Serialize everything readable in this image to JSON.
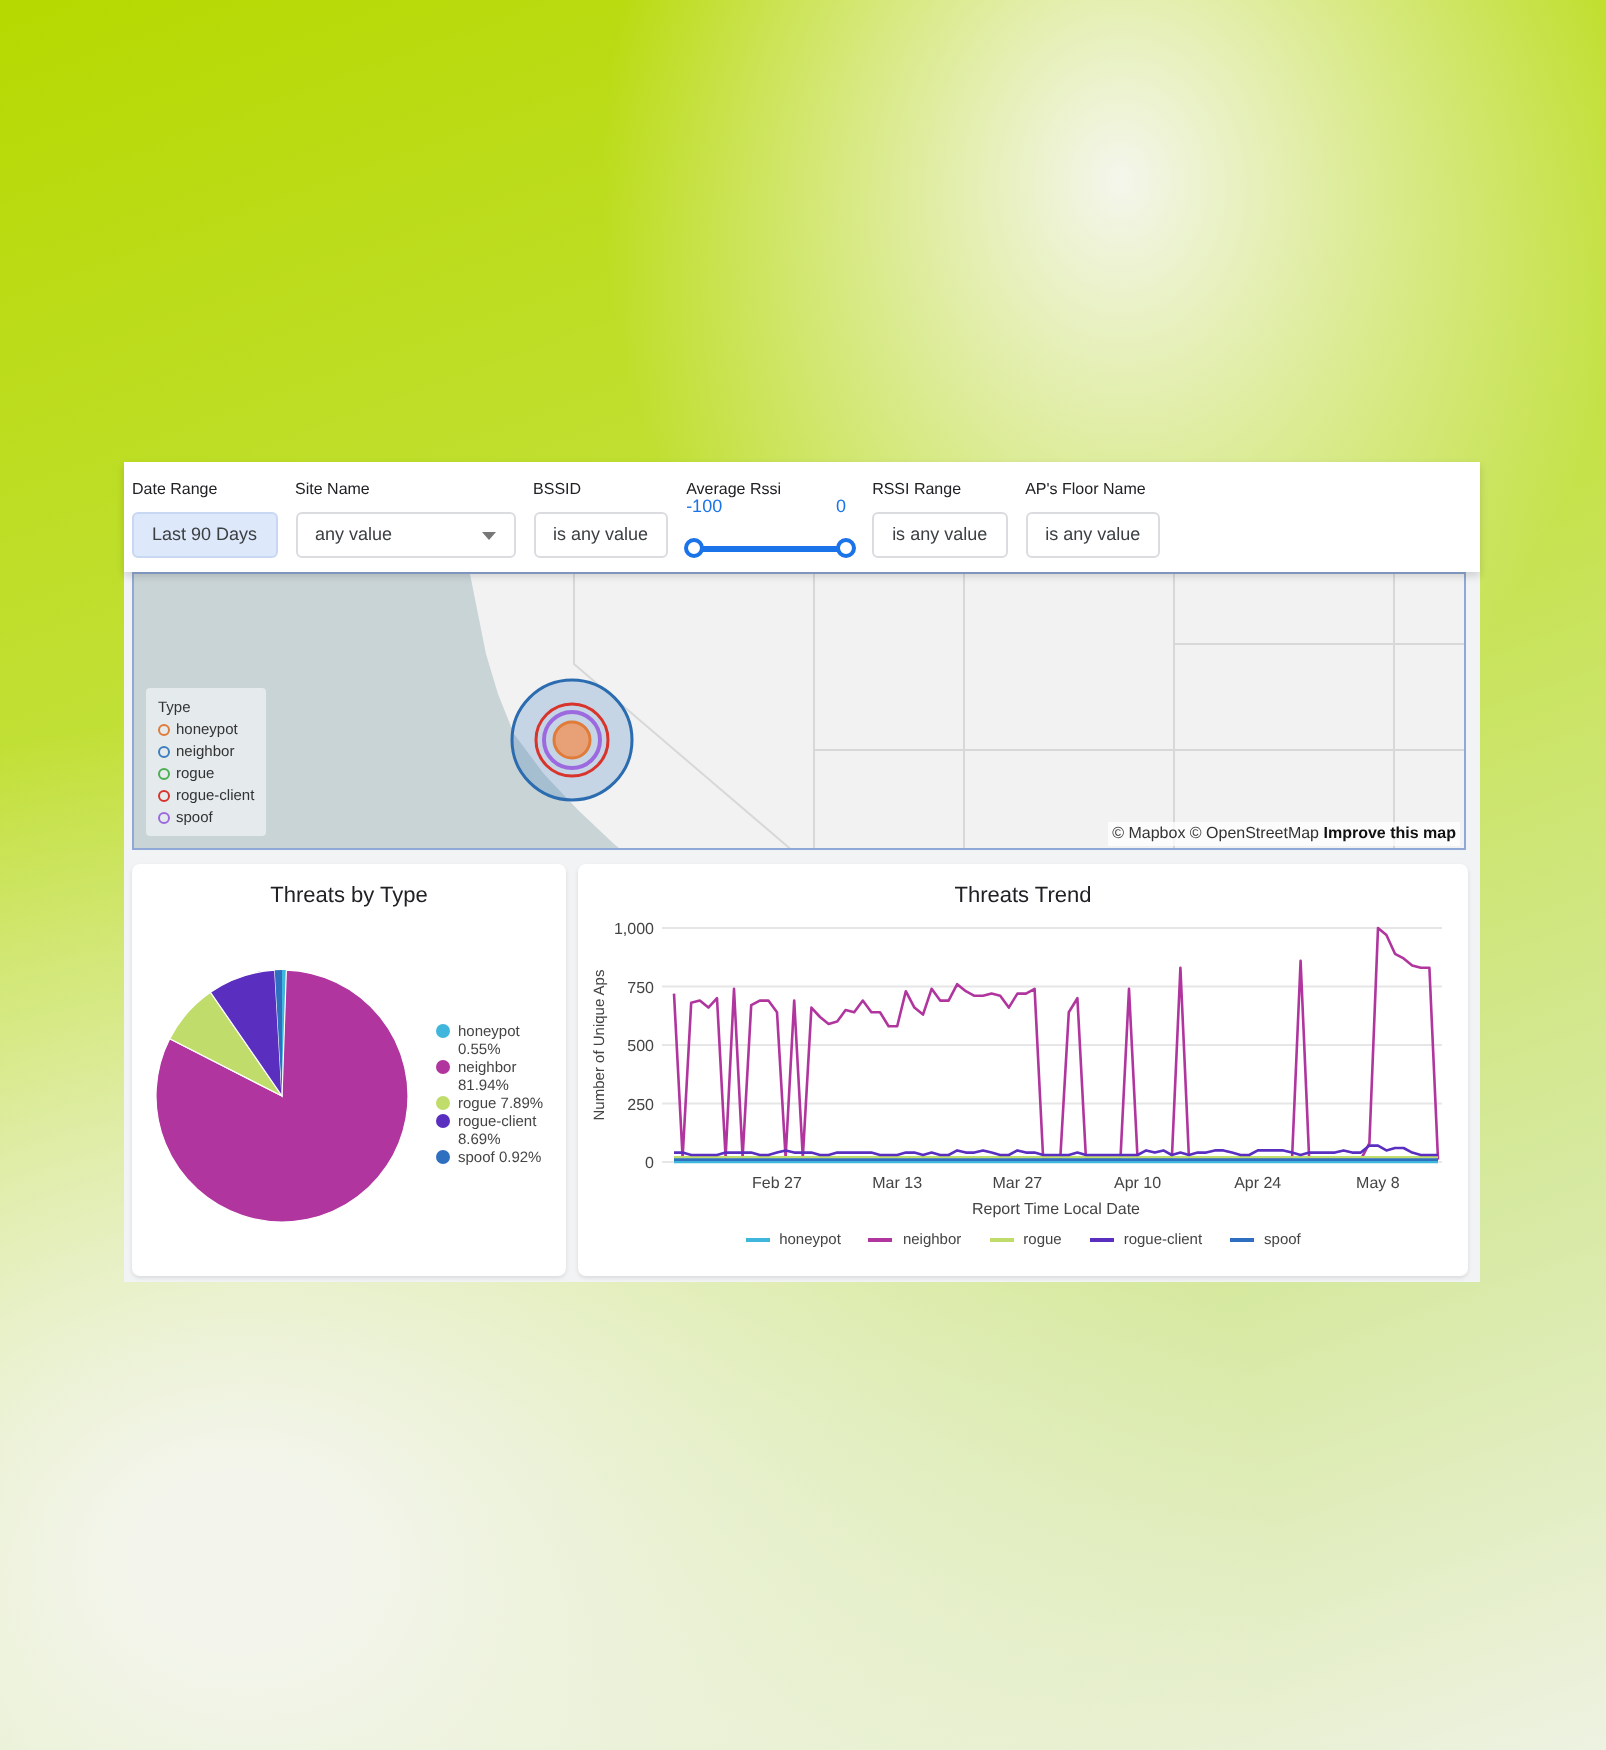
{
  "filters": [
    {
      "kind": "button",
      "label": "Date Range",
      "value": "Last 90 Days"
    },
    {
      "kind": "dropdown",
      "label": "Site Name",
      "value": "any value"
    },
    {
      "kind": "box",
      "label": "BSSID",
      "value": "is any value"
    },
    {
      "kind": "range",
      "label": "Average Rssi",
      "thumbs": [
        {
          "reading": "-100",
          "level": 0
        },
        {
          "reading": "0",
          "level": 1
        }
      ]
    },
    {
      "kind": "box",
      "label": "RSSI Range",
      "value": "is any value"
    },
    {
      "kind": "box",
      "label": "AP's Floor Name",
      "value": "is any value"
    }
  ],
  "map": {
    "legend_title": "Type",
    "legend": [
      {
        "label": "honeypot",
        "color": "#e07b39"
      },
      {
        "label": "neighbor",
        "color": "#3f7fbf"
      },
      {
        "label": "rogue",
        "color": "#4caf50"
      },
      {
        "label": "rogue-client",
        "color": "#d9342b"
      },
      {
        "label": "spoof",
        "color": "#9c6ade"
      }
    ],
    "attribution": "© Mapbox © OpenStreetMap",
    "improve_link": "Improve this map"
  },
  "pie_card": {
    "title": "Threats by Type",
    "legend_values": [
      "0.55%",
      "81.94%",
      "7.89%",
      "8.69%",
      "0.92%"
    ],
    "chart_data": {
      "type": "pie",
      "categories": [
        "honeypot",
        "neighbor",
        "rogue",
        "rogue-client",
        "spoof"
      ],
      "values": [
        0.55,
        81.94,
        7.89,
        8.69,
        0.92
      ],
      "colors": [
        "#3fb6dc",
        "#b0359e",
        "#c0dc6a",
        "#5a2fc0",
        "#2f6fc0"
      ]
    }
  },
  "trend_card": {
    "title": "Threats Trend",
    "chart_data": {
      "type": "line",
      "xlabel": "Report Time Local Date",
      "ylabel": "Number of Unique Aps",
      "categories": [
        null,
        null,
        null,
        null,
        null,
        null,
        null,
        null,
        null,
        null,
        null,
        null,
        "Feb 27",
        null,
        null,
        null,
        null,
        null,
        null,
        null,
        null,
        null,
        null,
        null,
        null,
        null,
        "Mar 13",
        null,
        null,
        null,
        null,
        null,
        null,
        null,
        null,
        null,
        null,
        null,
        null,
        null,
        "Mar 27",
        null,
        null,
        null,
        null,
        null,
        null,
        null,
        null,
        null,
        null,
        null,
        null,
        null,
        "Apr 10",
        null,
        null,
        null,
        null,
        null,
        null,
        null,
        null,
        null,
        null,
        null,
        null,
        null,
        "Apr 24",
        null,
        null,
        null,
        null,
        null,
        null,
        null,
        null,
        null,
        null,
        null,
        null,
        null,
        "May 8",
        null,
        null,
        null,
        null,
        null,
        null,
        null
      ],
      "ylim": [
        0,
        1000
      ],
      "grid": true,
      "yticks": [
        {
          "value": 0,
          "label": "0"
        },
        {
          "value": 250,
          "label": "250"
        },
        {
          "value": 500,
          "label": "500"
        },
        {
          "value": 750,
          "label": "750"
        },
        {
          "value": 1000,
          "label": "1,000"
        }
      ],
      "series": [
        {
          "name": "honeypot",
          "color": "#3fb6dc",
          "values": [
            0,
            0,
            0,
            0,
            0,
            0,
            0,
            0,
            0,
            0,
            0,
            0,
            0,
            0,
            0,
            0,
            0,
            0,
            0,
            0,
            0,
            0,
            0,
            0,
            0,
            0,
            0,
            0,
            0,
            0,
            0,
            0,
            0,
            0,
            0,
            0,
            0,
            0,
            0,
            0,
            0,
            0,
            0,
            0,
            0,
            0,
            0,
            0,
            0,
            0,
            0,
            0,
            0,
            0,
            0,
            0,
            0,
            0,
            0,
            0,
            0,
            0,
            0,
            0,
            0,
            0,
            0,
            0,
            0,
            0,
            0,
            0,
            0,
            0,
            0,
            0,
            0,
            0,
            0,
            0,
            0,
            0,
            0,
            0,
            0,
            0,
            0,
            0,
            0,
            0
          ]
        },
        {
          "name": "neighbor",
          "color": "#b0359e",
          "values": [
            720,
            20,
            680,
            690,
            660,
            700,
            20,
            740,
            20,
            670,
            690,
            690,
            640,
            20,
            690,
            20,
            660,
            620,
            590,
            600,
            650,
            640,
            690,
            640,
            640,
            580,
            580,
            730,
            660,
            630,
            740,
            690,
            690,
            760,
            730,
            710,
            710,
            720,
            710,
            660,
            720,
            720,
            740,
            10,
            10,
            10,
            640,
            700,
            10,
            10,
            10,
            10,
            10,
            740,
            10,
            10,
            10,
            10,
            10,
            830,
            10,
            10,
            10,
            10,
            10,
            10,
            10,
            10,
            10,
            10,
            10,
            10,
            10,
            860,
            10,
            10,
            10,
            10,
            10,
            10,
            10,
            80,
            1000,
            970,
            890,
            870,
            840,
            830,
            830,
            10
          ]
        },
        {
          "name": "rogue",
          "color": "#c0dc6a",
          "values": [
            20,
            20,
            20,
            20,
            20,
            20,
            20,
            20,
            20,
            20,
            20,
            20,
            20,
            20,
            20,
            20,
            20,
            20,
            20,
            20,
            20,
            20,
            20,
            20,
            20,
            20,
            20,
            20,
            20,
            20,
            20,
            20,
            20,
            20,
            20,
            20,
            20,
            20,
            20,
            20,
            20,
            20,
            20,
            20,
            20,
            20,
            20,
            20,
            20,
            20,
            20,
            20,
            20,
            20,
            20,
            20,
            20,
            20,
            20,
            20,
            20,
            20,
            20,
            20,
            20,
            20,
            20,
            20,
            20,
            20,
            20,
            20,
            20,
            20,
            20,
            20,
            20,
            20,
            20,
            20,
            20,
            20,
            20,
            20,
            20,
            20,
            20,
            20,
            20,
            20
          ]
        },
        {
          "name": "rogue-client",
          "color": "#5a2fc0",
          "values": [
            40,
            40,
            30,
            30,
            30,
            30,
            40,
            40,
            40,
            40,
            30,
            30,
            40,
            50,
            40,
            40,
            40,
            30,
            30,
            40,
            40,
            40,
            40,
            40,
            30,
            30,
            30,
            40,
            40,
            30,
            40,
            30,
            30,
            50,
            40,
            40,
            50,
            40,
            30,
            30,
            50,
            40,
            40,
            30,
            30,
            30,
            30,
            40,
            30,
            30,
            30,
            30,
            30,
            30,
            30,
            50,
            40,
            50,
            30,
            40,
            30,
            40,
            40,
            50,
            50,
            40,
            30,
            30,
            50,
            50,
            50,
            50,
            40,
            30,
            40,
            40,
            40,
            40,
            50,
            40,
            40,
            70,
            70,
            50,
            60,
            60,
            40,
            30,
            30,
            30
          ]
        },
        {
          "name": "spoof",
          "color": "#2f6fc0",
          "values": [
            10,
            10,
            10,
            10,
            10,
            10,
            10,
            10,
            10,
            10,
            10,
            10,
            10,
            10,
            10,
            10,
            10,
            10,
            10,
            10,
            10,
            10,
            10,
            10,
            10,
            10,
            10,
            10,
            10,
            10,
            10,
            10,
            10,
            10,
            10,
            10,
            10,
            10,
            10,
            10,
            10,
            10,
            10,
            10,
            10,
            10,
            10,
            10,
            10,
            10,
            10,
            10,
            10,
            10,
            10,
            10,
            10,
            10,
            10,
            10,
            10,
            10,
            10,
            10,
            10,
            10,
            10,
            10,
            10,
            10,
            10,
            10,
            10,
            10,
            10,
            10,
            10,
            10,
            10,
            10,
            10,
            10,
            10,
            10,
            10,
            10,
            10,
            10,
            10,
            10
          ]
        }
      ]
    }
  }
}
